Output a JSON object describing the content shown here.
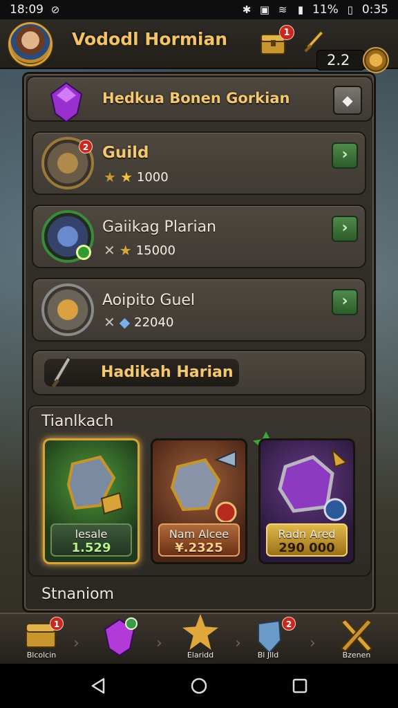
{
  "status_bar": {
    "time": "18:09",
    "battery": "11%",
    "clock": "0:35"
  },
  "header": {
    "player_name": "Vododl Hormian",
    "chest_badge": "1",
    "counter": "2.2"
  },
  "panel": {
    "banner_title": "Hedkua Bonen Gorkian",
    "rows": [
      {
        "title": "Guild",
        "badge": "2",
        "value": "1000"
      },
      {
        "title": "Gaiikag Plarian",
        "value": "15000"
      },
      {
        "title": "Aoipito Guel",
        "value": "22040"
      }
    ],
    "sub_banner": "Hadikah Harian",
    "section_title": "Tianlkach",
    "cards": [
      {
        "name": "lesale",
        "value": "1.529"
      },
      {
        "name": "Nam Alcee",
        "value": "¥.2325",
        "tag": "1"
      },
      {
        "name": "Radn Ared",
        "value": "290 000",
        "tag": "1"
      }
    ],
    "section2_title": "Stnaniom"
  },
  "bottom_nav": [
    {
      "label": "Blcolcin",
      "badge": "1"
    },
    {
      "label": ""
    },
    {
      "label": "Elaridd"
    },
    {
      "label": "Bl  Jlld",
      "badge": "2"
    },
    {
      "label": "Bzenen"
    }
  ],
  "colors": {
    "gold_text": "#f2c972",
    "panel": "#35312b",
    "go_button": "#4f8a4a",
    "badge_red": "#c8281f"
  }
}
